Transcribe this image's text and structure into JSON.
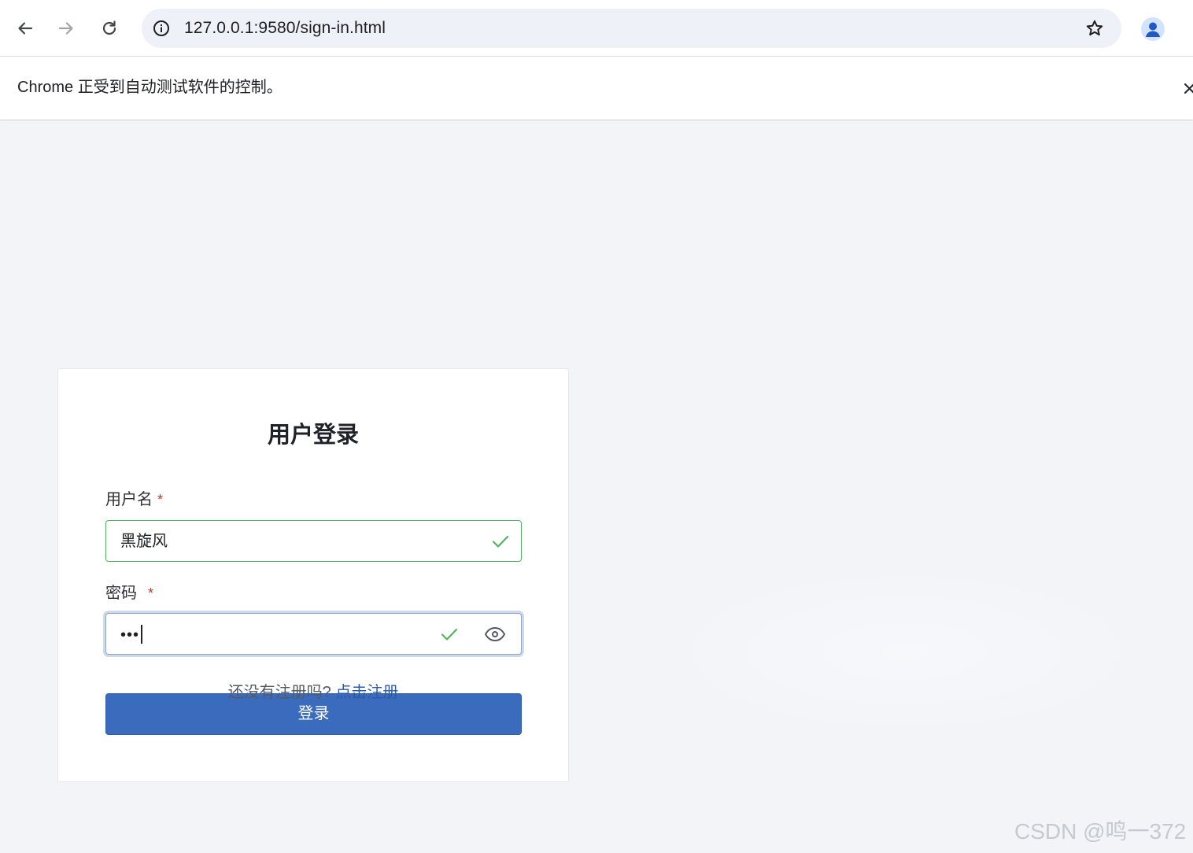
{
  "browser": {
    "url": "127.0.0.1:9580/sign-in.html",
    "infobar_message": "Chrome 正受到自动测试软件的控制。"
  },
  "login": {
    "title": "用户登录",
    "username": {
      "label": "用户名",
      "required_mark": "*",
      "value": "黑旋风"
    },
    "password": {
      "label": "密码",
      "required_mark": "*",
      "value": "•••"
    },
    "submit_label": "登录",
    "register_prompt": "还没有注册吗?",
    "register_link": "点击注册"
  },
  "watermark": "CSDN @鸣一372",
  "colors": {
    "primary": "#3a6bbd",
    "valid": "#52b35e",
    "required": "#c0392b",
    "link": "#2d5aa8"
  }
}
